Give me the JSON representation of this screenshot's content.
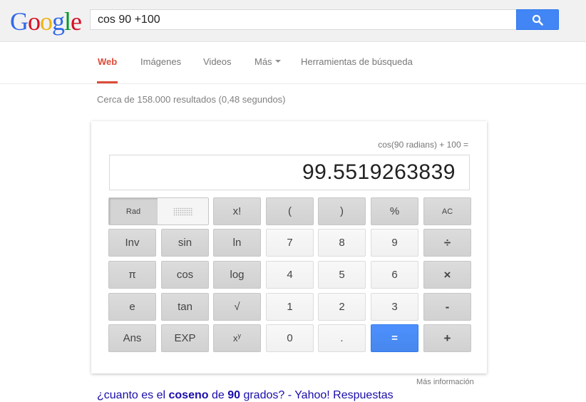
{
  "logo": {
    "letters": [
      "G",
      "o",
      "o",
      "g",
      "l",
      "e"
    ]
  },
  "search": {
    "query": "cos 90 +100",
    "button_icon": "search-icon"
  },
  "tabs": [
    {
      "label": "Web",
      "active": true
    },
    {
      "label": "Imágenes"
    },
    {
      "label": "Videos"
    },
    {
      "label": "Más",
      "has_caret": true
    },
    {
      "label": "Herramientas de búsqueda"
    }
  ],
  "stats": "Cerca de 158.000 resultados (0,48 segundos)",
  "calculator": {
    "expression": "cos(90 radians) + 100 =",
    "result": "99.5519263839",
    "mode": {
      "rad_label": "Rad",
      "deg_icon": "grid-dots-icon"
    },
    "keys": {
      "fact": "x!",
      "lparen": "(",
      "rparen": ")",
      "percent": "%",
      "ac": "AC",
      "inv": "Inv",
      "sin": "sin",
      "ln": "ln",
      "seven": "7",
      "eight": "8",
      "nine": "9",
      "divide": "÷",
      "pi": "π",
      "cos": "cos",
      "log": "log",
      "four": "4",
      "five": "5",
      "six": "6",
      "multiply": "×",
      "e": "e",
      "tan": "tan",
      "sqrt": "√",
      "one": "1",
      "two": "2",
      "three": "3",
      "minus": "-",
      "ans": "Ans",
      "exp": "EXP",
      "pow_base": "x",
      "pow_exp": "y",
      "zero": "0",
      "dot": ".",
      "equals": "=",
      "plus": "+"
    }
  },
  "more_info": "Más información",
  "result_link": {
    "pre": "¿cuanto es el ",
    "b1": "coseno",
    "mid": " de ",
    "b2": "90",
    "post": " grados? - Yahoo! Respuestas"
  },
  "colors": {
    "accent_red": "#dd4b39",
    "search_blue": "#4285f4",
    "equals_blue": "#4d90fe",
    "link": "#1a0dab"
  }
}
